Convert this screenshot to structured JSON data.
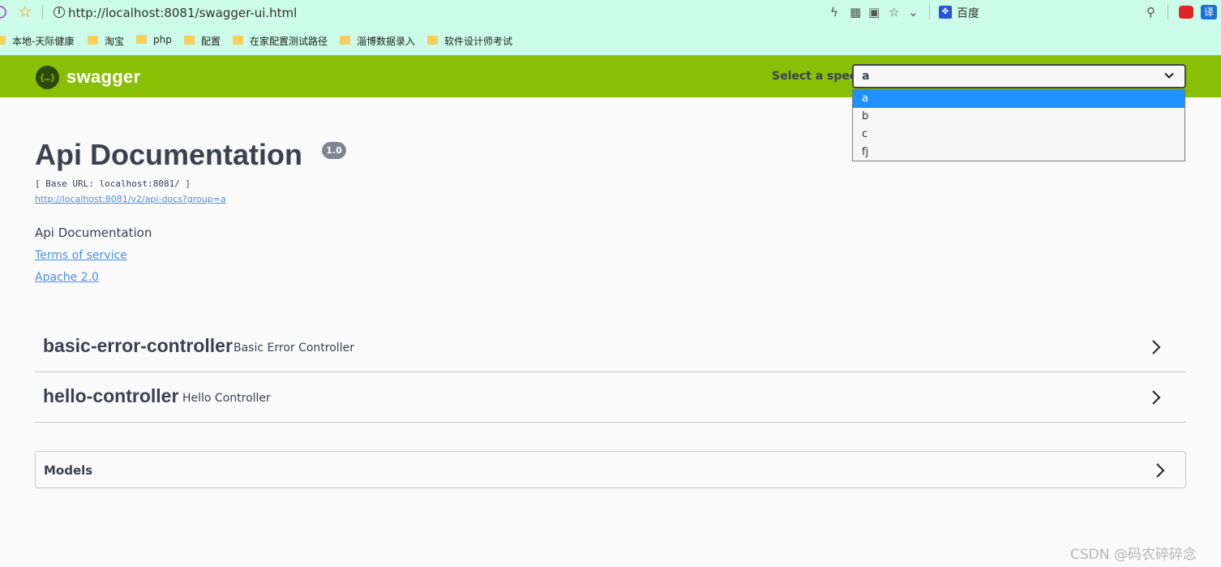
{
  "browser": {
    "url": "http://localhost:8081/swagger-ui.html",
    "search_engine": "百度",
    "ext_label": "译",
    "bookmarks": [
      "本地-天际健康",
      "淘宝",
      "php",
      "配置",
      "在家配置测试路径",
      "淄博数据录入",
      "软件设计师考试"
    ]
  },
  "header": {
    "logo_text": "swagger",
    "logo_glyph": "{…}",
    "spec_label": "Select a spec",
    "spec_value": "a",
    "spec_options": [
      "a",
      "b",
      "c",
      "fj"
    ]
  },
  "info": {
    "title": "Api Documentation",
    "version": "1.0",
    "base_url": "[ Base URL: localhost:8081/ ]",
    "docs_url": "http://localhost:8081/v2/api-docs?group=a",
    "description": "Api Documentation",
    "terms_label": "Terms of service",
    "license_label": "Apache 2.0"
  },
  "tags": [
    {
      "name": "basic-error-controller",
      "description": "Basic Error Controller"
    },
    {
      "name": "hello-controller",
      "description": "Hello Controller"
    }
  ],
  "models": {
    "label": "Models"
  },
  "watermark": "CSDN @码农碎碎念",
  "colors": {
    "header_green": "#89bf04",
    "link_blue": "#4990e2",
    "text_dark": "#3b4151",
    "selected_option": "#1e90ff"
  }
}
